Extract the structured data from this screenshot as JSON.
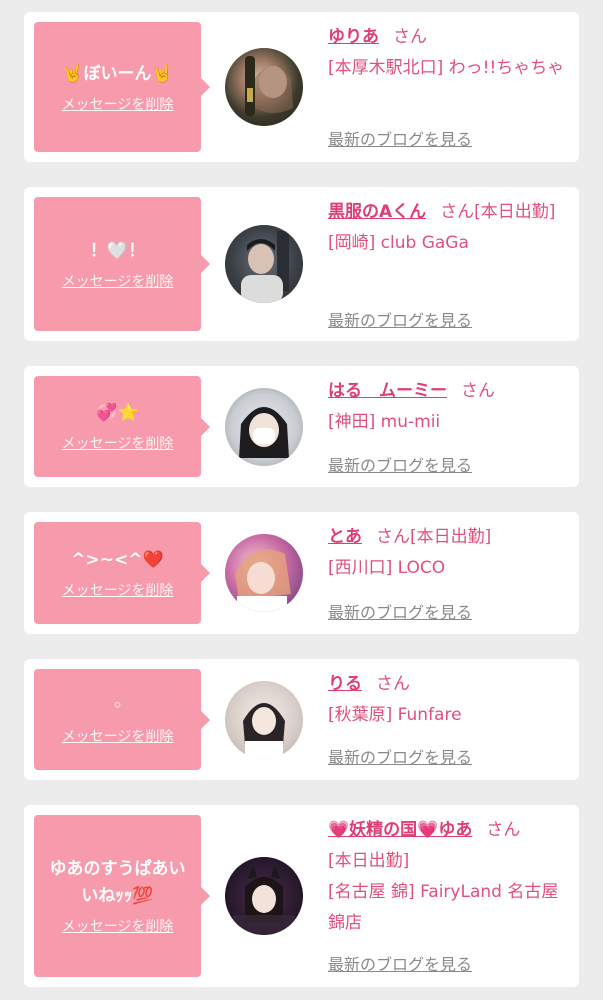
{
  "cards": [
    {
      "message": "🤘ぼいーん🤘",
      "delete_label": "メッセージを削除",
      "name": "ゆりあ",
      "honorific": "さん",
      "detail_lines": [
        "[本厚木駅北口] わっ!!ちゃちゃ"
      ],
      "blog_label": "最新のブログを見る"
    },
    {
      "message": "！🤍！",
      "delete_label": "メッセージを削除",
      "name": "黒服のAくん",
      "honorific": "さん",
      "name_suffix": "[本日出勤]",
      "detail_lines": [
        "[岡崎] club GaGa"
      ],
      "blog_label": "最新のブログを見る"
    },
    {
      "message": "💞⭐",
      "delete_label": "メッセージを削除",
      "name": "はる　ムーミー",
      "honorific": "さん",
      "detail_lines": [
        "[神田] mu-mii"
      ],
      "blog_label": "最新のブログを見る"
    },
    {
      "message": "^>~<^❤️",
      "delete_label": "メッセージを削除",
      "name": "とあ",
      "honorific": "さん",
      "name_suffix": "[本日出勤]",
      "detail_lines": [
        "[西川口] LOCO"
      ],
      "blog_label": "最新のブログを見る"
    },
    {
      "message": "⚬",
      "delete_label": "メッセージを削除",
      "name": "りる",
      "honorific": "さん",
      "detail_lines": [
        "[秋葉原] Funfare"
      ],
      "blog_label": "最新のブログを見る"
    },
    {
      "message": "ゆあのすうぱあいいねｯｯ💯",
      "delete_label": "メッセージを削除",
      "name": "💗妖精の国💗ゆあ",
      "honorific": "さん",
      "detail_lines": [
        "[本日出勤]",
        "[名古屋 錦] FairyLand 名古屋錦店"
      ],
      "blog_label": "最新のブログを見る"
    }
  ],
  "colors": {
    "bubble": "#f79aab",
    "name": "#e03d75",
    "text": "#e1507a",
    "link_gray": "#8a8a8a",
    "background": "#ececec"
  }
}
